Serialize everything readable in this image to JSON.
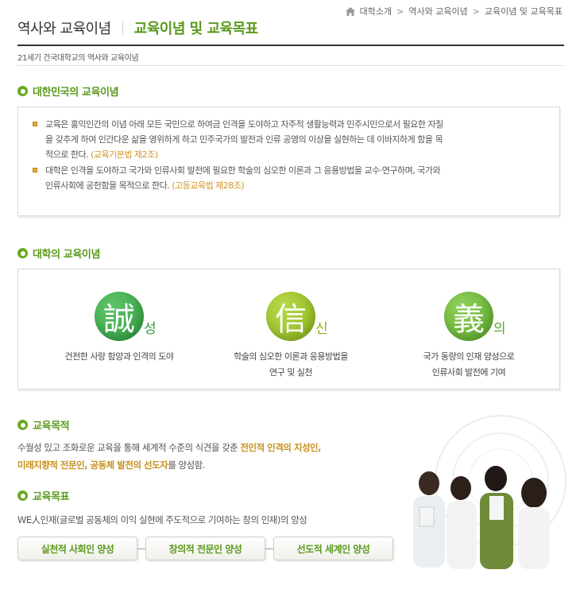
{
  "breadcrumb": {
    "items": [
      "대학소개",
      "역사와 교육이념",
      "교육이념 및 교육목표"
    ],
    "separator": ">"
  },
  "header": {
    "title": "역사와 교육이념",
    "subtitle_title": "교육이념 및 교육목표",
    "description": "21세기 건국대학교의 역사와 교육이념"
  },
  "korea_section": {
    "heading": "대한민국의 교육이념",
    "paragraphs": [
      {
        "line1": "교육은 홍익인간의 이념 아래 모든 국민으로 하여금 인격을 도야하고 자주적 생활능력과 민주시민으로서 필요한 자질",
        "line2": "을 갖추게 하여 인간다운 삶을 영위하게 하고 민주국가의 발전과 인류 공영의 이상을 실현하는 데 이바지하게 함을 목",
        "line3": "적으로 한다.",
        "law": "(교육기본법 제2조)"
      },
      {
        "line1": "대학은 인격을 도야하고 국가와 인류사회 발전에 필요한 학술의 심오한 이론과 그 응용방법을 교수·연구하며, 국가와",
        "line2": "인류사회에 공헌함을 목적으로 한다.",
        "law": "(고등교육법 제28조)"
      }
    ]
  },
  "university_section": {
    "heading": "대학의 교육이념",
    "values": [
      {
        "hanja": "誠",
        "hangul": "성",
        "line1": "건전한 사랑 함양과 인격의 도야",
        "line2": ""
      },
      {
        "hanja": "信",
        "hangul": "신",
        "line1": "학술의 심오한 이론과 응용방법을",
        "line2": "연구 및 실천"
      },
      {
        "hanja": "義",
        "hangul": "의",
        "line1": "국가 동량의 인재 양성으로",
        "line2": "인류사회 발전에 기여"
      }
    ]
  },
  "purpose_section": {
    "heading": "교육목적",
    "text_before": "수월성 있고 조화로운 교육을 통해 세계적 수준의 식견을 갖춘 ",
    "emphasis_1": "전인적 인격의 지성인,",
    "emphasis_2": "미래지향적 전문인, 공동체 발전의 선도자",
    "text_after": "를 양성함."
  },
  "goal_section": {
    "heading": "교육목표",
    "text": "WE人인재(글로벌 공동체의 이익 실현에 주도적으로 기여하는 창의 인재)의 양성",
    "buttons": [
      "실천적 사회인 양성",
      "창의적 전문인 양성",
      "선도적 세계인 양성"
    ]
  },
  "colors": {
    "accent_green": "#5a9a1c",
    "law_orange": "#d19426",
    "emphasis_gold": "#c8901e"
  },
  "icons": [
    "home-icon",
    "circle-bullet-icon",
    "square-bullet-icon"
  ]
}
